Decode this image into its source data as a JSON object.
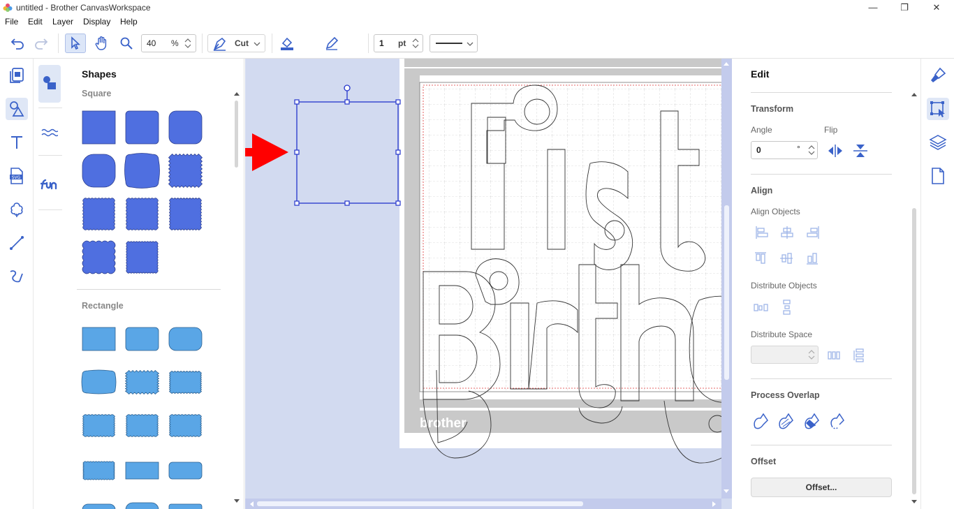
{
  "window": {
    "title": "untitled - Brother CanvasWorkspace",
    "minimize": "—",
    "restore": "❐",
    "close": "✕"
  },
  "menu": [
    "File",
    "Edit",
    "Layer",
    "Display",
    "Help"
  ],
  "toolbar": {
    "zoom_value": "40",
    "zoom_unit": "%",
    "mode_label": "Cut",
    "line_width_value": "1",
    "line_width_unit": "pt",
    "stroke_color": "#000000",
    "fill_color": "transparent"
  },
  "shapes_panel": {
    "title": "Shapes",
    "square_section": "Square",
    "rectangle_section": "Rectangle",
    "square_color": "#4f6fe0",
    "rectangle_color": "#5aa6e6"
  },
  "canvas": {
    "watermark": "brother",
    "design_text": [
      "First",
      "Birthday"
    ],
    "selection_color": "#2233cc",
    "arrow_color": "#ff0000"
  },
  "edit_panel": {
    "title": "Edit",
    "transform": "Transform",
    "angle_label": "Angle",
    "angle_value": "0",
    "angle_unit": "°",
    "flip_label": "Flip",
    "align": "Align",
    "align_objects": "Align Objects",
    "distribute_objects": "Distribute Objects",
    "distribute_space": "Distribute Space",
    "distribute_space_value": "",
    "process_overlap": "Process Overlap",
    "offset": "Offset",
    "offset_button": "Offset..."
  }
}
